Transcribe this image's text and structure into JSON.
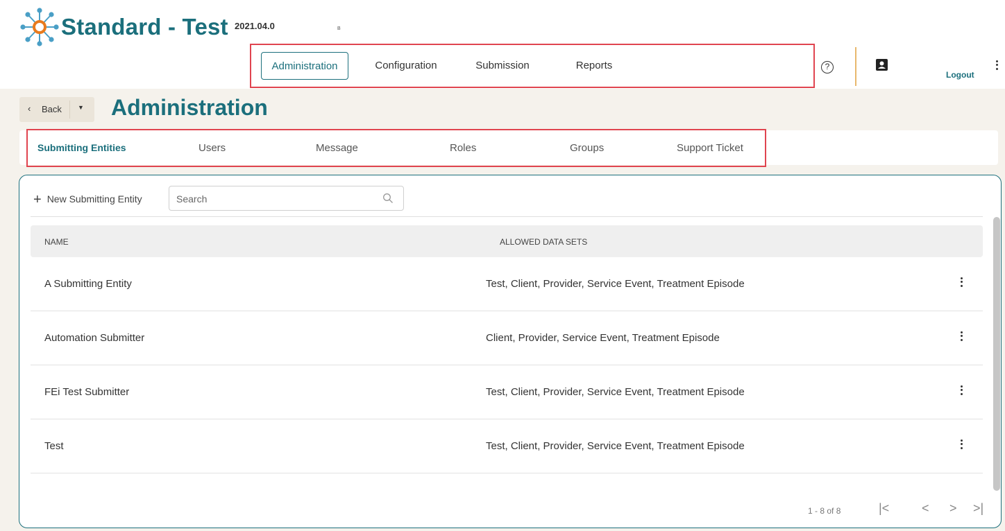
{
  "app": {
    "title": "Standard - Test",
    "version": "2021.04.0",
    "mark": "B",
    "brand_color": "#1b6f7c",
    "accent_orange": "#e87a1d",
    "highlight_red": "#e0444f"
  },
  "main_nav": {
    "items": [
      {
        "label": "Administration",
        "active": true
      },
      {
        "label": "Configuration",
        "active": false
      },
      {
        "label": "Submission",
        "active": false
      },
      {
        "label": "Reports",
        "active": false
      }
    ]
  },
  "header_actions": {
    "help_glyph": "?",
    "help_icon": "help-circle-icon",
    "profile_icon": "account-box-icon",
    "logout_label": "Logout",
    "more_icon": "kebab-icon"
  },
  "page": {
    "back_label": "Back",
    "back_chevron": "‹",
    "back_dropdown": "▼",
    "title": "Administration"
  },
  "sub_tabs": [
    {
      "label": "Submitting Entities",
      "active": true
    },
    {
      "label": "Users",
      "active": false
    },
    {
      "label": "Message",
      "active": false
    },
    {
      "label": "Roles",
      "active": false
    },
    {
      "label": "Groups",
      "active": false
    },
    {
      "label": "Support Ticket",
      "active": false
    }
  ],
  "toolbar": {
    "plus_glyph": "+",
    "new_label": "New Submitting Entity",
    "search_placeholder": "Search",
    "search_value": ""
  },
  "table": {
    "columns": [
      "NAME",
      "ALLOWED DATA SETS"
    ],
    "rows": [
      {
        "name": "A Submitting Entity",
        "sets": "Test, Client, Provider, Service Event, Treatment Episode"
      },
      {
        "name": "Automation Submitter",
        "sets": "Client, Provider, Service Event, Treatment Episode"
      },
      {
        "name": "FEi Test Submitter",
        "sets": "Test, Client, Provider, Service Event, Treatment Episode"
      },
      {
        "name": "Test",
        "sets": "Test, Client, Provider, Service Event, Treatment Episode"
      }
    ]
  },
  "pagination": {
    "range_text": "1 - 8 of 8",
    "first": "|<",
    "prev": "<",
    "next": ">",
    "last": ">|"
  }
}
